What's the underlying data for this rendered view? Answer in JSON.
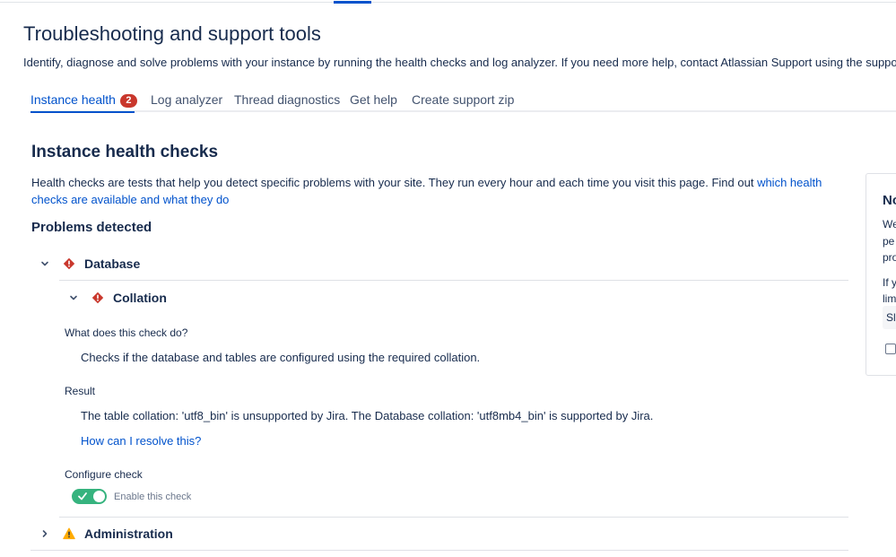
{
  "page": {
    "title": "Troubleshooting and support tools",
    "description": "Identify, diagnose and solve problems with your instance by running the health checks and log analyzer. If you need more help, contact Atlassian Support using the suppo"
  },
  "tabs": [
    {
      "label": "Instance health",
      "badge": "2",
      "active": true
    },
    {
      "label": "Log analyzer"
    },
    {
      "label": "Thread diagnostics"
    },
    {
      "label": "Get help"
    },
    {
      "label": "Create support zip"
    }
  ],
  "health": {
    "title": "Instance health checks",
    "description": "Health checks are tests that help you detect specific problems with your site. They run every hour and each time you visit this page. Find out ",
    "description_link": "which health checks are available and what they do",
    "problems_title": "Problems detected"
  },
  "groups": {
    "database": {
      "label": "Database",
      "icon": "error-icon"
    },
    "administration": {
      "label": "Administration",
      "icon": "warning-icon"
    }
  },
  "check": {
    "label": "Collation",
    "what_label": "What does this check do?",
    "what_text": "Checks if the database and tables are configured using the required collation.",
    "result_label": "Result",
    "result_text": "The table collation: 'utf8_bin' is unsupported by Jira. The Database collation: 'utf8mb4_bin' is supported by Jira.",
    "resolve_link": "How can I resolve this?",
    "configure_label": "Configure check",
    "toggle_label": "Enable this check",
    "toggle_on": true
  },
  "side_card": {
    "title": "No",
    "lines": [
      "We",
      "pe",
      "pro",
      "If y",
      "lim"
    ],
    "input_value": "Sl"
  },
  "colors": {
    "brand": "#0052cc",
    "error": "#c9372c",
    "warning": "#ffab00",
    "success": "#36b37e"
  }
}
